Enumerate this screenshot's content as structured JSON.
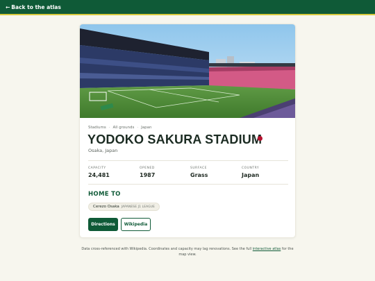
{
  "header": {
    "back_arrow": "←",
    "back_label": "Back to the atlas",
    "bg_color": "#0f5a37",
    "accent_color": "#d7c93c"
  },
  "stadium": {
    "breadcrumbs": [
      "Stadiums",
      "All grounds",
      "Japan"
    ],
    "breadcrumb_separator": "·",
    "name": "YODOKO SAKURA STADIUM",
    "flag_icon": "japan-flag-dot",
    "flag_color": "#b5122f",
    "location": "Osaka, Japan",
    "photo_icon": "stadium-photo",
    "stats": [
      {
        "label": "CAPACITY",
        "value": "24,481"
      },
      {
        "label": "OPENED",
        "value": "1987"
      },
      {
        "label": "SURFACE",
        "value": "Grass"
      },
      {
        "label": "COUNTRY",
        "value": "Japan"
      }
    ],
    "home_to_heading": "HOME TO",
    "clubs": [
      {
        "name": "Cerezo Osaka",
        "league": "JAPANESE J1 LEAGUE"
      }
    ],
    "actions": {
      "directions_label": "Directions",
      "wikipedia_label": "Wikipedia"
    }
  },
  "footer": {
    "text_before": "Data cross-referenced with Wikipedia. Coordinates and capacity may lag renovations. See the full ",
    "link_text": "interactive atlas",
    "text_after": " for the map view."
  }
}
